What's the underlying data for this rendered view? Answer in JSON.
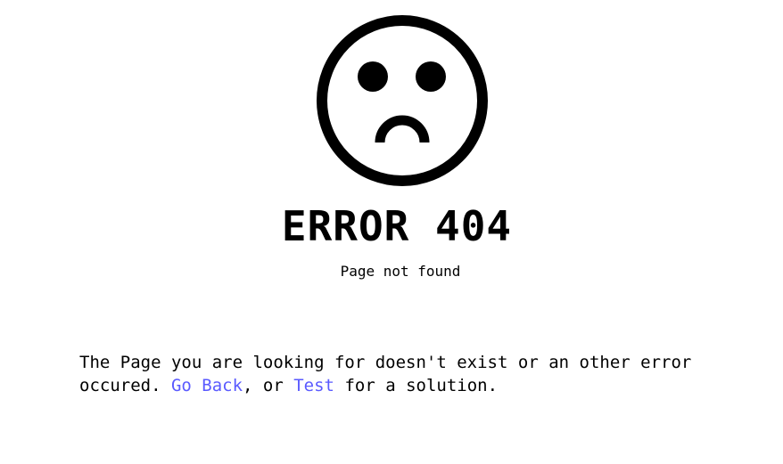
{
  "error": {
    "title": "ERROR 404",
    "subtitle": "Page not found"
  },
  "message": {
    "text_before": "The Page you are looking for doesn't exist or an other error occured. ",
    "link_back": "Go Back",
    "text_middle": ", or ",
    "link_test": "Test",
    "text_after": " for a solution."
  },
  "colors": {
    "link": "#5a5aff",
    "text": "#000000",
    "background": "#ffffff"
  },
  "icons": {
    "face": "sad-face-icon"
  }
}
